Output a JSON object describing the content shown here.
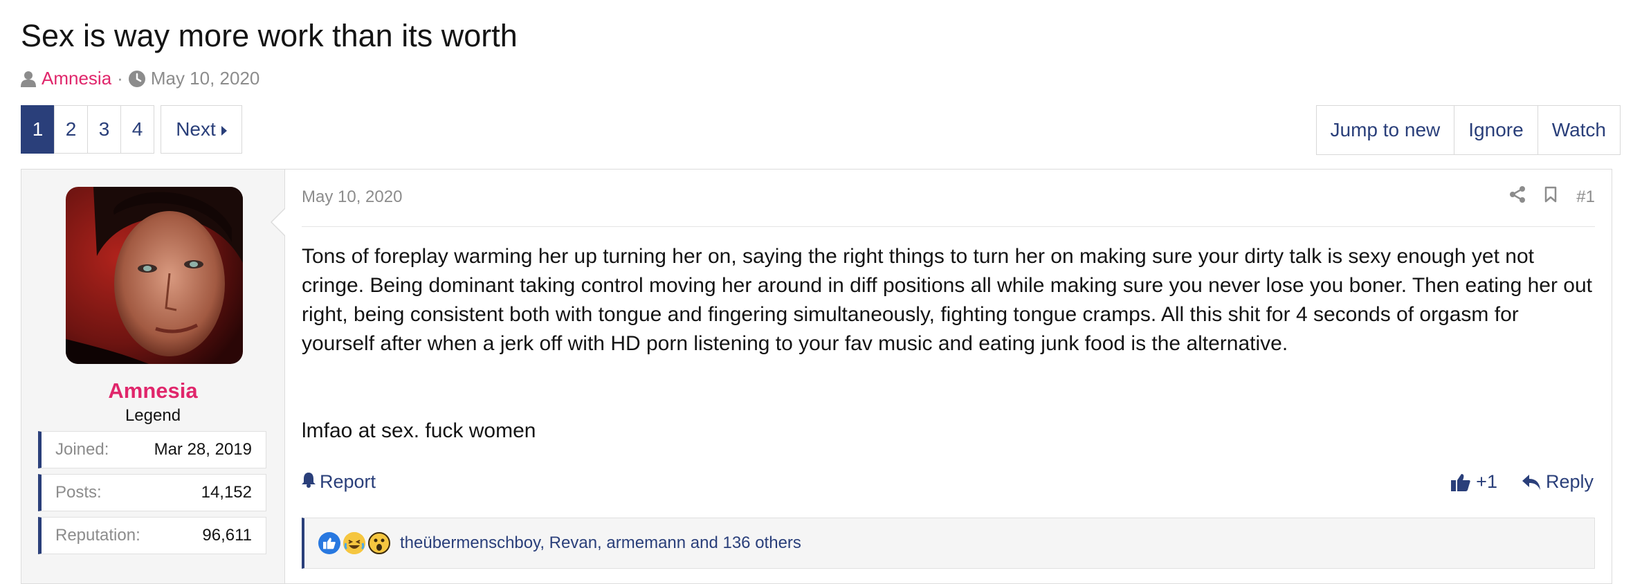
{
  "thread": {
    "title": "Sex is way more work than its worth",
    "author": "Amnesia",
    "separator": "·",
    "date": "May 10, 2020"
  },
  "pagination": {
    "pages": [
      "1",
      "2",
      "3",
      "4"
    ],
    "current": "1",
    "next_label": "Next"
  },
  "actions": {
    "jump_to_new": "Jump to new",
    "ignore": "Ignore",
    "watch": "Watch"
  },
  "user": {
    "name": "Amnesia",
    "title": "Legend",
    "stats": [
      {
        "label": "Joined:",
        "value": "Mar 28, 2019"
      },
      {
        "label": "Posts:",
        "value": "14,152"
      },
      {
        "label": "Reputation:",
        "value": "96,611"
      }
    ]
  },
  "post": {
    "date": "May 10, 2020",
    "number": "#1",
    "paragraph1": "Tons of foreplay warming her up turning her on, saying the right things to turn her on making sure your dirty talk is sexy enough yet not cringe. Being dominant taking control moving her around in diff positions all while making sure you never lose you boner. Then eating her out right, being consistent both with tongue and fingering simultaneously, fighting tongue cramps. All this shit for 4 seconds of orgasm for yourself after when a jerk off with HD porn listening to your fav music and eating junk food is the alternative.",
    "paragraph2": "lmfao at sex. fuck women",
    "report_label": "Report",
    "like_label": "+1",
    "reply_label": "Reply",
    "reactions_text": "theübermenschboy, Revan, armemann and 136 others"
  },
  "colors": {
    "accent": "#2a3f7a",
    "author": "#e0266b",
    "muted": "#8c8c8c"
  },
  "icons": [
    "user-icon",
    "clock-icon",
    "caret-right-icon",
    "share-icon",
    "bookmark-icon",
    "bell-icon",
    "thumbs-up-icon",
    "reply-icon",
    "reaction-like-icon",
    "reaction-haha-icon",
    "reaction-wow-icon"
  ]
}
